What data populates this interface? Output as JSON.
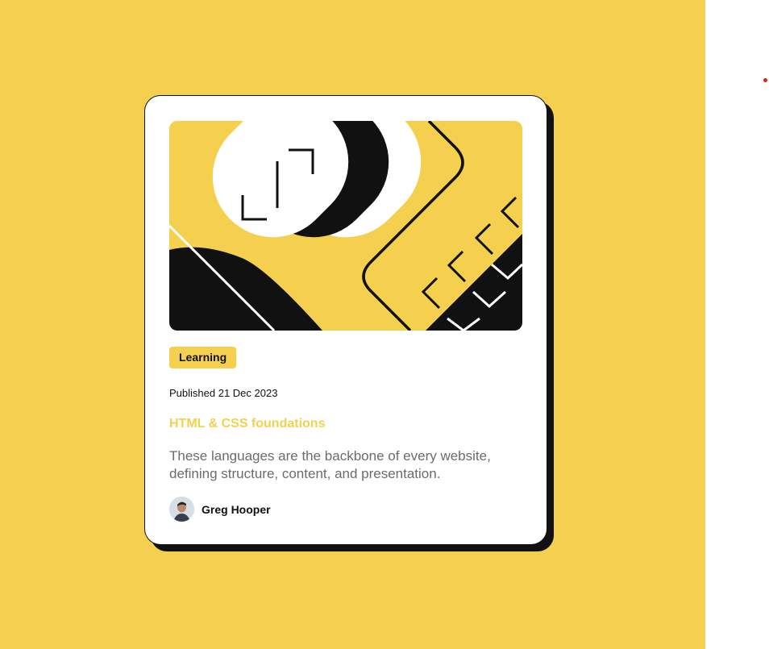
{
  "colors": {
    "accent": "#f4d04e",
    "ink": "#111111",
    "muted_text": "#6b6b6b",
    "page_right": "#ffffff",
    "dot": "#e02020"
  },
  "card": {
    "hero_image": "blog illustration",
    "tag": "Learning",
    "published": "Published 21 Dec 2023",
    "title": "HTML & CSS foundations",
    "description": "These languages are the backbone of every website, defining structure, content, and presentation.",
    "author": {
      "avatar": "avatar",
      "name": "Greg Hooper"
    }
  }
}
